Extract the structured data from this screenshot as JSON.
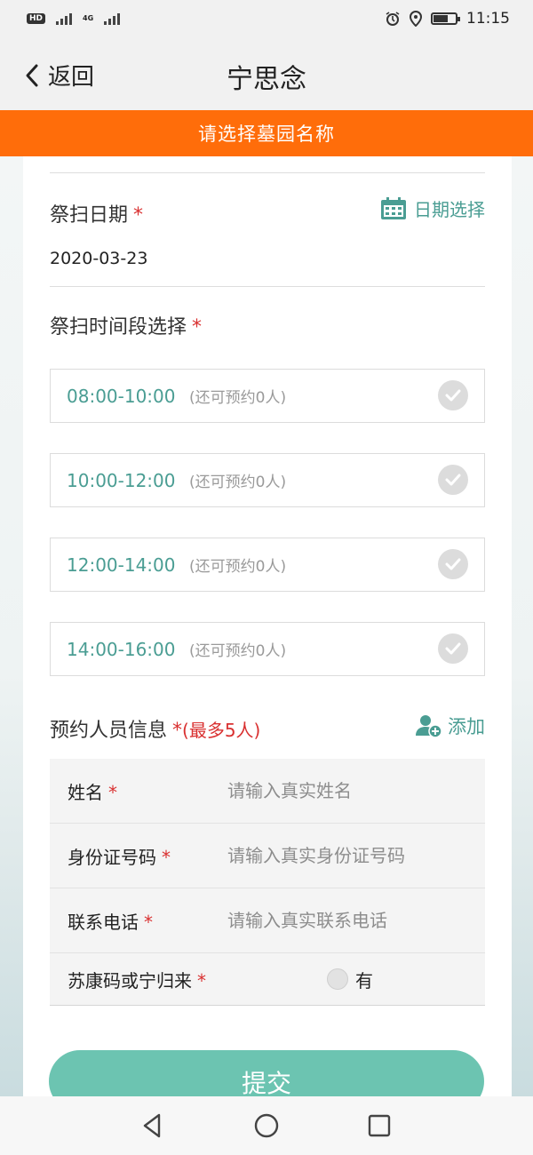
{
  "status_bar": {
    "time": "11:15",
    "hd": "HD",
    "network": "4G"
  },
  "nav": {
    "back_label": "返回",
    "title": "宁思念"
  },
  "cemetery_select": {
    "label": "请选择墓园名称"
  },
  "date_section": {
    "label": "祭扫日期",
    "required": "*",
    "picker_label": "日期选择",
    "value": "2020-03-23"
  },
  "slot_section": {
    "label": "祭扫时间段选择",
    "required": "*",
    "slots": [
      {
        "time": "08:00-10:00",
        "quota": "(还可预约0人)"
      },
      {
        "time": "10:00-12:00",
        "quota": "(还可预约0人)"
      },
      {
        "time": "12:00-14:00",
        "quota": "(还可预约0人)"
      },
      {
        "time": "14:00-16:00",
        "quota": "(还可预约0人)"
      }
    ]
  },
  "persons_section": {
    "label": "预约人员信息",
    "required": "*",
    "max_note": "(最多5人)",
    "add_label": "添加"
  },
  "form": {
    "name_label": "姓名",
    "name_placeholder": "请输入真实姓名",
    "id_label": "身份证号码",
    "id_placeholder": "请输入真实身份证号码",
    "phone_label": "联系电话",
    "phone_placeholder": "请输入真实联系电话",
    "health_label": "苏康码或宁归来",
    "health_option": "有",
    "required": "*"
  },
  "submit_label": "提交",
  "colors": {
    "accent": "#4a9d93",
    "orange_bar": "#ff6d0a",
    "submit": "#6cc4b1",
    "required": "#d93030"
  },
  "icons": [
    "back-chevron-icon",
    "calendar-icon",
    "check-circle-icon",
    "add-person-icon",
    "nav-back-icon",
    "nav-home-icon",
    "nav-recents-icon"
  ]
}
